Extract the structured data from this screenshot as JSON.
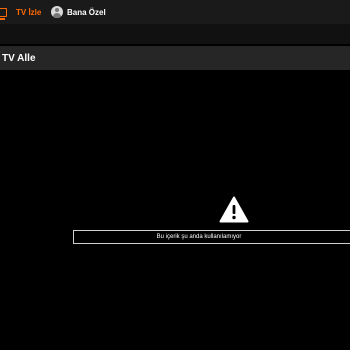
{
  "nav": {
    "tv_label": "TV İzle",
    "ozel_label": "Bana Özel",
    "tv_icon": "tv-icon",
    "ozel_icon": "user-avatar-icon",
    "active_color": "#ff6a00"
  },
  "page": {
    "title": "TV Alle"
  },
  "message": {
    "icon": "warning-icon",
    "text": "Bu içerik şu anda kullanılamıyor"
  }
}
